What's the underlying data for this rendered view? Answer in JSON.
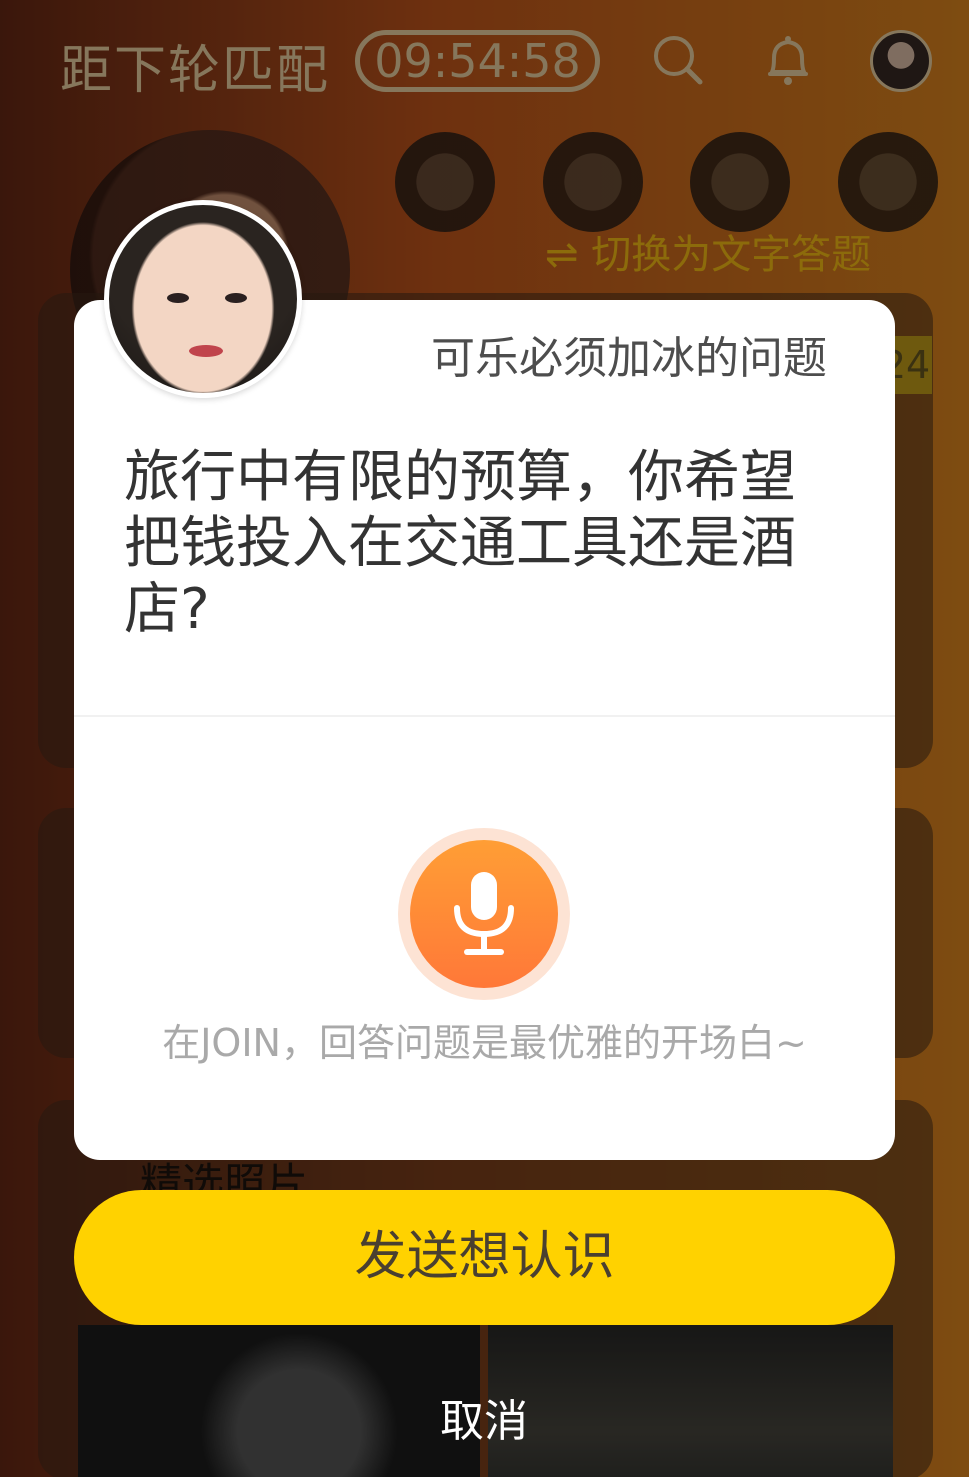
{
  "background": {
    "countdown_label": "距下轮匹配",
    "countdown_timer": "09:54:58",
    "switch_link": "⇌ 切换为文字答题",
    "card_tag": "24",
    "section_title": "精选照片"
  },
  "dialog": {
    "heading": "可乐必须加冰的问题",
    "question": "旅行中有限的预算，你希望把钱投入在交通工具还是酒店?",
    "hint": "在JOIN，回答问题是最优雅的开场白~",
    "mic_icon": "microphone-icon"
  },
  "actions": {
    "send_label": "发送想认识",
    "cancel_label": "取消"
  },
  "colors": {
    "accent_yellow": "#ffd200",
    "mic_orange": "#ff8a38",
    "switch_link": "#ffc414"
  }
}
